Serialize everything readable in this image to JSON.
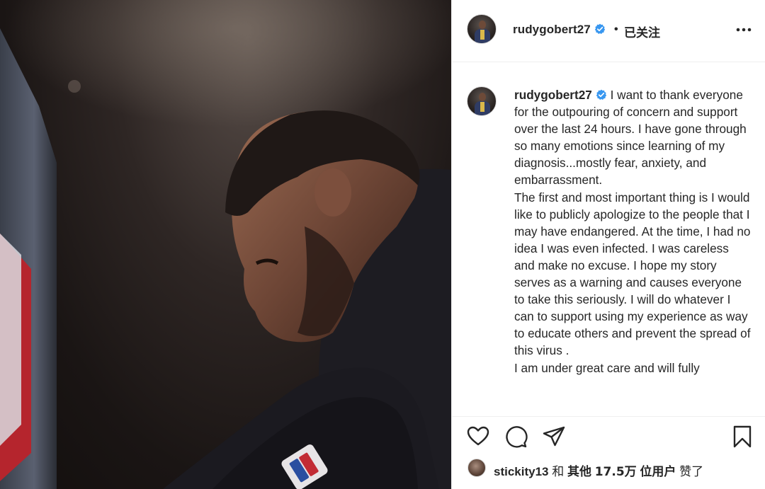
{
  "post": {
    "username": "rudygobert27",
    "follow_state": "已关注",
    "separator": "•",
    "caption_paragraphs": [
      "I want to thank everyone for the outpouring of concern and support over the last 24 hours. I have gone through so many emotions since learning of my diagnosis...mostly fear, anxiety, and embarrassment.",
      "The first and most important thing is I would like to publicly apologize to the people that I may have endangered. At the time, I had no idea I was even infected. I was careless and make no excuse. I hope my story serves as a warning and causes everyone to take this seriously. I will do whatever I can to support using my experience as way to educate others and prevent the spread of this virus .",
      "I am under great care and will fully"
    ]
  },
  "likes": {
    "liker": "stickity13",
    "and": "和",
    "others": "其他",
    "count": "17.5万",
    "units": "位用户",
    "liked": "赞了"
  },
  "icons": {
    "more": "more-options-icon",
    "verified": "verified-badge-icon",
    "like": "heart-icon",
    "comment": "comment-icon",
    "share": "share-icon",
    "save": "bookmark-icon"
  },
  "colors": {
    "verified_blue": "#3897f0",
    "text": "#262626",
    "divider": "#efefef"
  }
}
